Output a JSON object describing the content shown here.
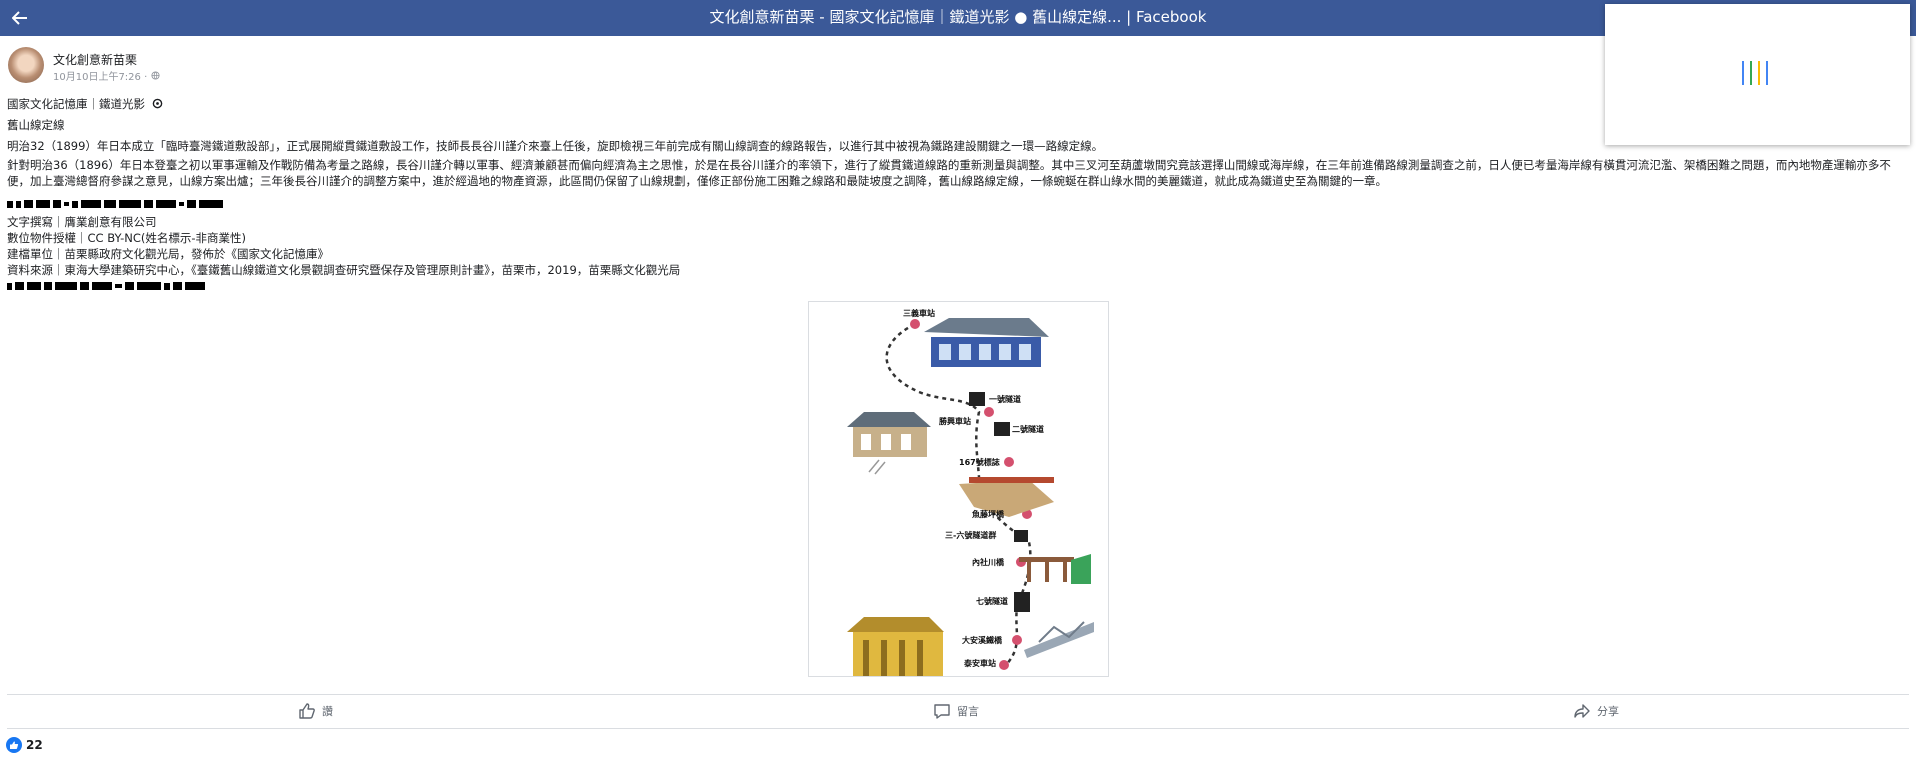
{
  "window": {
    "title": "文化創意新苗栗 - 國家文化記憶庫｜鐵道光影 ● 舊山線定線... | Facebook"
  },
  "post": {
    "page_name": "文化創意新苗栗",
    "timestamp": "10月10日上午7:26 ·",
    "lines": {
      "header": "國家文化記憶庫｜鐵道光影",
      "subtitle": "舊山線定線",
      "para1": "明治32（1899）年日本成立「臨時臺灣鐵道敷設部」，正式展開縱貫鐵道敷設工作，技師長長谷川謹介來臺上任後，旋即檢視三年前完成有關山線調查的線路報告，以進行其中被視為鐵路建設關鍵之一環—路線定線。",
      "para2": "針對明治36（1896）年日本登臺之初以軍事運輸及作戰防備為考量之路線，長谷川謹介轉以軍事、經濟兼顧甚而偏向經濟為主之思惟，於是在長谷川謹介的率領下，進行了縱貫鐵道線路的重新測量與調整。其中三叉河至葫蘆墩間究竟該選擇山間線或海岸線，在三年前進備路線測量調查之前，日人便已考量海岸線有橫貫河流氾濫、架橋困難之問題，而內地物產運輸亦多不便，加上臺灣總督府參謀之意見，山線方案出爐；三年後長谷川謹介的調整方案中，進於經過地的物產資源，此區間仍保留了山線規劃，僅修正部份施工困難之線路和最陡坡度之調降，舊山線路線定線，一條蜿蜒在群山綠水間的美麗鐵道，就此成為鐵道史至為關鍵的一章。",
      "author": "文字撰寫｜膺業創意有限公司",
      "license": "數位物件授權｜CC BY-NC(姓名標示-非商業性)",
      "publisher": "建檔單位｜苗栗縣政府文化觀光局，發佈於《國家文化記憶庫》",
      "source": "資料來源｜東海大學建築研究中心，《臺鐵舊山線鐵道文化景觀調查研究暨保存及管理原則計畫》，苗栗市，2019，苗栗縣文化觀光局"
    },
    "map": {
      "stations": [
        "三義車站",
        "勝興車站",
        "泰安車站"
      ],
      "features": [
        "一號隧道",
        "二號隧道",
        "167號標誌",
        "魚藤坪橋",
        "三-六號隧道群",
        "內社川橋",
        "七號隧道",
        "大安溪鐵橋"
      ]
    },
    "actions": {
      "like": "讚",
      "comment": "留言",
      "share": "分享"
    },
    "reactions": {
      "count": "22"
    }
  },
  "colors": {
    "header_bg": "#3b5998",
    "reaction_blue": "#1877f2",
    "rail_track": "#333333",
    "station_marker": "#d4506e"
  },
  "icons": [
    "back-arrow-icon",
    "globe-icon",
    "like-icon",
    "comment-icon",
    "share-icon",
    "like-reaction-icon"
  ]
}
